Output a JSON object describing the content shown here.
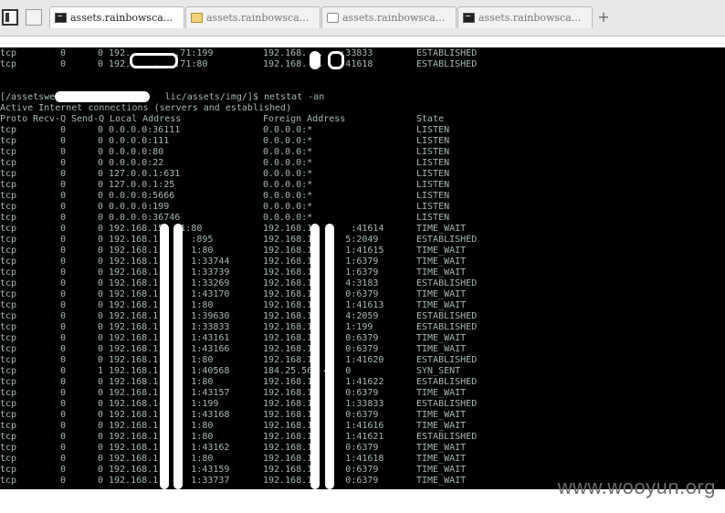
{
  "tabs": [
    {
      "label": "",
      "icon": "panel-toggle-icon"
    },
    {
      "label": "",
      "icon": "tab-grid-icon"
    },
    {
      "label": "assets.rainbowsca...",
      "icon": "terminal-icon",
      "active": true
    },
    {
      "label": "assets.rainbowsca...",
      "icon": "folder-icon"
    },
    {
      "label": "assets.rainbowsca...",
      "icon": "page-icon"
    },
    {
      "label": "assets.rainbowsca...",
      "icon": "terminal-icon"
    }
  ],
  "new_tab_label": "+",
  "terminal": {
    "top_lines": [
      {
        "proto": "tcp",
        "recv": "0",
        "send": "0",
        "local": "0 192.    .   .71:199",
        "foreign": "192.168.  .   :33833",
        "state": "ESTABLISHED"
      },
      {
        "proto": "tcp",
        "recv": "0",
        "send": "0",
        "local": "0 192.    .   .71:80",
        "foreign": "192.168.  .   :41618",
        "state": "ESTABLISHED"
      }
    ],
    "prompt": "[/assetswe                    lic/assets/img/]$ netstat -an",
    "info": "Active Internet connections (servers and established)",
    "headers": {
      "proto": "Proto",
      "recv": "Recv-Q",
      "send": "Send-Q",
      "local": "Local Address",
      "foreign": "Foreign Address",
      "state": "State"
    },
    "rows": [
      {
        "proto": "tcp",
        "recv": "0",
        "send": "0",
        "local": "0.0.0.0:36111",
        "foreign": "0.0.0.0:*",
        "state": "LISTEN"
      },
      {
        "proto": "tcp",
        "recv": "0",
        "send": "0",
        "local": "0.0.0.0:111",
        "foreign": "0.0.0.0:*",
        "state": "LISTEN"
      },
      {
        "proto": "tcp",
        "recv": "0",
        "send": "0",
        "local": "0.0.0.0:80",
        "foreign": "0.0.0.0:*",
        "state": "LISTEN"
      },
      {
        "proto": "tcp",
        "recv": "0",
        "send": "0",
        "local": "0.0.0.0:22",
        "foreign": "0.0.0.0:*",
        "state": "LISTEN"
      },
      {
        "proto": "tcp",
        "recv": "0",
        "send": "0",
        "local": "127.0.0.1:631",
        "foreign": "0.0.0.0:*",
        "state": "LISTEN"
      },
      {
        "proto": "tcp",
        "recv": "0",
        "send": "0",
        "local": "127.0.0.1:25",
        "foreign": "0.0.0.0:*",
        "state": "LISTEN"
      },
      {
        "proto": "tcp",
        "recv": "0",
        "send": "0",
        "local": "0.0.0.0:5666",
        "foreign": "0.0.0.0:*",
        "state": "LISTEN"
      },
      {
        "proto": "tcp",
        "recv": "0",
        "send": "0",
        "local": "0.0.0.0:199",
        "foreign": "0.0.0.0:*",
        "state": "LISTEN"
      },
      {
        "proto": "tcp",
        "recv": "0",
        "send": "0",
        "local": "0.0.0.0:36746",
        "foreign": "0.0.0.0:*",
        "state": "LISTEN"
      },
      {
        "proto": "tcp",
        "recv": "0",
        "send": "0",
        "local": "192.168.15   1:80",
        "foreign": "192.168.1   1   :41614",
        "state": "TIME_WAIT"
      },
      {
        "proto": "tcp",
        "recv": "0",
        "send": "0",
        "local": "192.168.1      :895",
        "foreign": "192.168.1      5:2049",
        "state": "ESTABLISHED"
      },
      {
        "proto": "tcp",
        "recv": "0",
        "send": "0",
        "local": "192.168.1      1:80",
        "foreign": "192.168.1      1:41615",
        "state": "TIME_WAIT"
      },
      {
        "proto": "tcp",
        "recv": "0",
        "send": "0",
        "local": "192.168.1      1:33744",
        "foreign": "192.168.1      1:6379",
        "state": "TIME_WAIT"
      },
      {
        "proto": "tcp",
        "recv": "0",
        "send": "0",
        "local": "192.168.1      1:33739",
        "foreign": "192.168.1      1:6379",
        "state": "TIME_WAIT"
      },
      {
        "proto": "tcp",
        "recv": "0",
        "send": "0",
        "local": "192.168.1      1:33269",
        "foreign": "192.168.1      4:3183",
        "state": "ESTABLISHED"
      },
      {
        "proto": "tcp",
        "recv": "0",
        "send": "0",
        "local": "192.168.1      1:43170",
        "foreign": "192.168.1      0:6379",
        "state": "TIME_WAIT"
      },
      {
        "proto": "tcp",
        "recv": "0",
        "send": "0",
        "local": "192.168.1      1:80",
        "foreign": "192.168.1      1:41613",
        "state": "TIME_WAIT"
      },
      {
        "proto": "tcp",
        "recv": "0",
        "send": "0",
        "local": "192.168.1      1:39630",
        "foreign": "192.168.1      4:2059",
        "state": "ESTABLISHED"
      },
      {
        "proto": "tcp",
        "recv": "0",
        "send": "0",
        "local": "192.168.1      1:33833",
        "foreign": "192.168.1      1:199",
        "state": "ESTABLISHED"
      },
      {
        "proto": "tcp",
        "recv": "0",
        "send": "0",
        "local": "192.168.1      1:43161",
        "foreign": "192.168.1      0:6379",
        "state": "TIME_WAIT"
      },
      {
        "proto": "tcp",
        "recv": "0",
        "send": "0",
        "local": "192.168.1      1:43166",
        "foreign": "192.168.1      0:6379",
        "state": "TIME_WAIT"
      },
      {
        "proto": "tcp",
        "recv": "0",
        "send": "0",
        "local": "192.168.1      1:80",
        "foreign": "192.168.1      1:41620",
        "state": "ESTABLISHED"
      },
      {
        "proto": "tcp",
        "recv": "0",
        "send": "1",
        "local": "192.168.1      1:40568",
        "foreign": "184.25.56  4   0",
        "state": "SYN_SENT"
      },
      {
        "proto": "tcp",
        "recv": "0",
        "send": "0",
        "local": "192.168.1      1:80",
        "foreign": "192.168.1      1:41622",
        "state": "ESTABLISHED"
      },
      {
        "proto": "tcp",
        "recv": "0",
        "send": "0",
        "local": "192.168.1      1:43157",
        "foreign": "192.168.1      0:6379",
        "state": "TIME_WAIT"
      },
      {
        "proto": "tcp",
        "recv": "0",
        "send": "0",
        "local": "192.168.1      1:199",
        "foreign": "192.168.1      1:33833",
        "state": "ESTABLISHED"
      },
      {
        "proto": "tcp",
        "recv": "0",
        "send": "0",
        "local": "192.168.1      1:43168",
        "foreign": "192.168.1      0:6379",
        "state": "TIME_WAIT"
      },
      {
        "proto": "tcp",
        "recv": "0",
        "send": "0",
        "local": "192.168.1      1:80",
        "foreign": "192.168.1      1:41616",
        "state": "TIME_WAIT"
      },
      {
        "proto": "tcp",
        "recv": "0",
        "send": "0",
        "local": "192.168.1      1:80",
        "foreign": "192.168.1      1:41621",
        "state": "ESTABLISHED"
      },
      {
        "proto": "tcp",
        "recv": "0",
        "send": "0",
        "local": "192.168.1      1:43162",
        "foreign": "192.168.1      0:6379",
        "state": "TIME_WAIT"
      },
      {
        "proto": "tcp",
        "recv": "0",
        "send": "0",
        "local": "192.168.1      1:80",
        "foreign": "192.168.1      1:41618",
        "state": "TIME_WAIT"
      },
      {
        "proto": "tcp",
        "recv": "0",
        "send": "0",
        "local": "192.168.1      1:43159",
        "foreign": "192.168.1      0:6379",
        "state": "TIME_WAIT"
      },
      {
        "proto": "tcp",
        "recv": "0",
        "send": "0",
        "local": "192.168.1      1:33737",
        "foreign": "192.168.1      0:6379",
        "state": "TIME_WAIT"
      }
    ]
  },
  "watermark": "www.wooyun.org",
  "colors": {
    "terminal_bg": "#000000",
    "terminal_text": "#a7b7b7",
    "redaction": "#ffffff"
  }
}
